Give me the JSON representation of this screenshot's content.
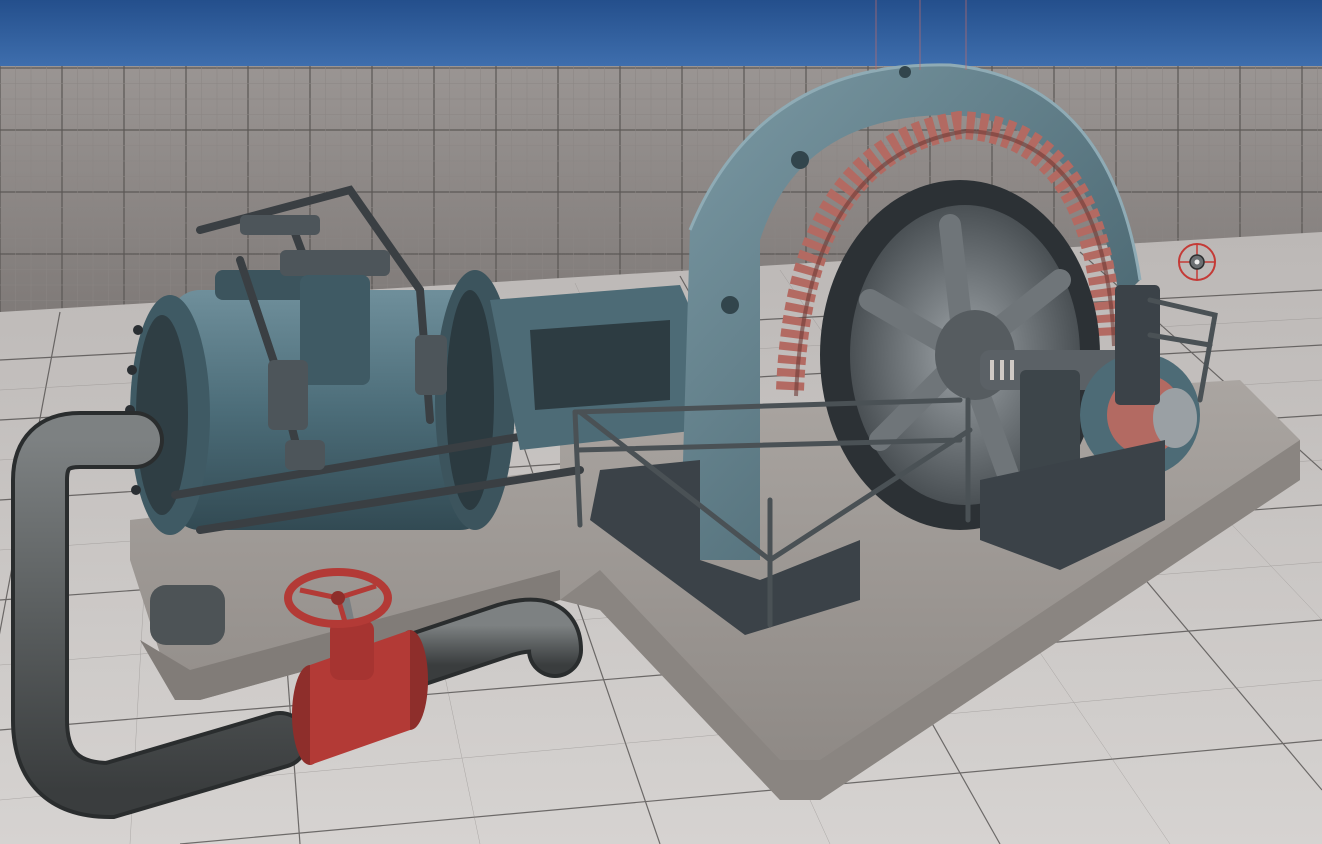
{
  "scene": {
    "sky_color": "#2f5f9e",
    "wall_color": "#8c8785",
    "floor_color": "#c9c6c4",
    "grid_line_color": "#3a3838",
    "machine_body_color": "#4d6f7c",
    "machine_dark_color": "#3b4248",
    "copper_coil_color": "#b36a62",
    "valve_color": "#b33a36",
    "pipe_color": "#5e6263",
    "concrete_color": "#9f9a96"
  },
  "icons": {
    "viewport_gizmo": "reflection-capture-icon"
  }
}
